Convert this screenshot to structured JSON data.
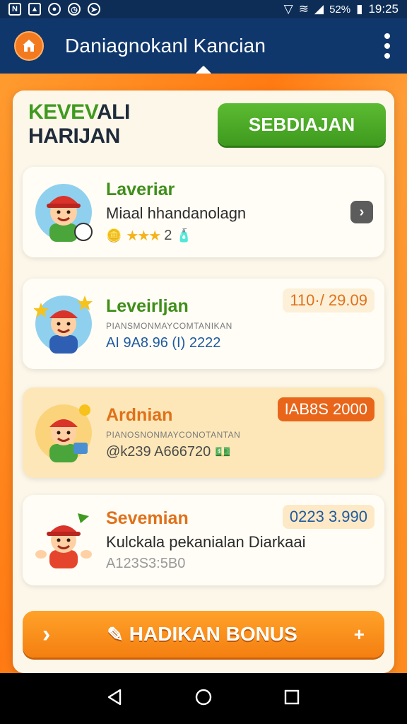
{
  "status_bar": {
    "battery": "52%",
    "time": "19:25"
  },
  "app_bar": {
    "title": "Daniagnokanl Kancian"
  },
  "panel": {
    "title_accent": "KEVEV",
    "title_rest": "ALI HARIJAN",
    "action_label": "SEBDIAJAN"
  },
  "cards": [
    {
      "name": "Laveriar",
      "name_color": "#3f8f1a",
      "description": "Miaal hhandanolagn",
      "meta_rating": "2"
    },
    {
      "name": "Leveirljan",
      "name_color": "#3f8f1a",
      "sub": "PIANSMONMAYCOMTANIKAN",
      "meta": "AI 9A8.96 (I) 2222",
      "value": "110·/ 29.09",
      "value_color": "#e0711a"
    },
    {
      "name": "Ardnian",
      "name_color": "#e0711a",
      "sub": "PIANOSNONMAYCONOTANTAN",
      "meta": "@k239 A666720",
      "value": "IAB8S 2000",
      "value_color": "#ffffff",
      "value_bg": "#e9651a"
    },
    {
      "name": "Sevemian",
      "name_color": "#e0711a",
      "description": "Kulckala pekanialan Diarkaai",
      "meta": "A123S3:5B0",
      "value": "0223 3.990",
      "value_color": "#1f5aa0",
      "value_bg": "#fde9c6"
    }
  ],
  "bonus_button": {
    "label": "HADIKAN BONUS"
  },
  "icons": {
    "home": "home-icon",
    "menu": "more-vert-icon",
    "chevron": "chevron-right-icon"
  }
}
